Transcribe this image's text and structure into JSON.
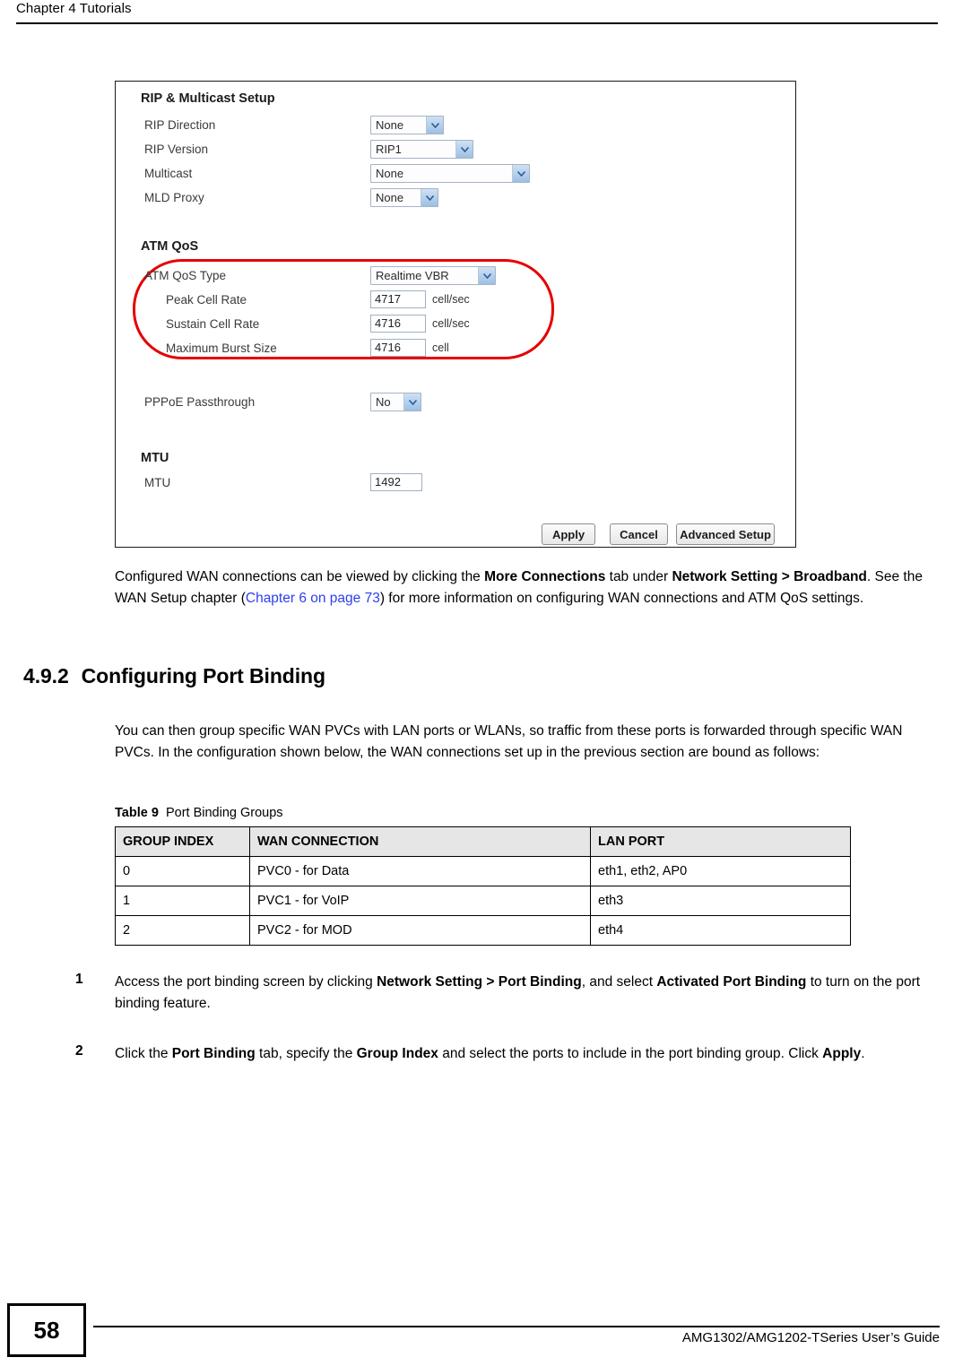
{
  "header": {
    "chapter": "Chapter 4 Tutorials"
  },
  "screenshot": {
    "rip_section": {
      "title": "RIP & Multicast Setup",
      "fields": [
        {
          "label": "RIP Direction",
          "value": "None"
        },
        {
          "label": "RIP Version",
          "value": "RIP1"
        },
        {
          "label": "Multicast",
          "value": "None"
        },
        {
          "label": "MLD Proxy",
          "value": "None"
        }
      ]
    },
    "atm_section": {
      "title": "ATM QoS",
      "qos_type": {
        "label": "ATM QoS Type",
        "value": "Realtime VBR"
      },
      "rates": [
        {
          "label": "Peak Cell Rate",
          "value": "4717",
          "unit": "cell/sec"
        },
        {
          "label": "Sustain Cell Rate",
          "value": "4716",
          "unit": "cell/sec"
        },
        {
          "label": "Maximum Burst Size",
          "value": "4716",
          "unit": "cell"
        }
      ],
      "highlight_color": "#e60000"
    },
    "pppoe": {
      "label": "PPPoE Passthrough",
      "value": "No"
    },
    "mtu_section": {
      "title": "MTU",
      "label": "MTU",
      "value": "1492"
    },
    "buttons": {
      "apply": "Apply",
      "cancel": "Cancel",
      "advanced": "Advanced Setup"
    }
  },
  "intro_paragraph": {
    "p1": "Configured WAN connections can be viewed by clicking the ",
    "b1": "More Connections",
    "p2": " tab under ",
    "b2": "Network Setting",
    "p3": " > ",
    "b3": "Broadband",
    "p4": ". See the WAN Setup chapter (",
    "xref": "Chapter 6 on page 73",
    "p5": ") for more information on configuring WAN connections and ATM QoS settings."
  },
  "section": {
    "number": "4.9.2",
    "title": "Configuring Port Binding",
    "paragraph": "You can then group specific WAN PVCs with LAN ports or WLANs, so traffic from these ports is forwarded through specific WAN PVCs. In the configuration shown below, the WAN connections set up in the previous section are bound as follows:"
  },
  "table": {
    "caption_label": "Table 9",
    "caption_title": "Port Binding Groups",
    "headers": [
      "GROUP INDEX",
      "WAN CONNECTION",
      "LAN PORT"
    ],
    "rows": [
      [
        "0",
        "PVC0 - for Data",
        "eth1, eth2, AP0"
      ],
      [
        "1",
        "PVC1 - for VoIP",
        "eth3"
      ],
      [
        "2",
        "PVC2 - for MOD",
        "eth4"
      ]
    ]
  },
  "steps": [
    {
      "num": "1",
      "t1": "Access the port binding screen by clicking ",
      "b1": "Network Setting",
      "t2": " > ",
      "b2": "Port Binding",
      "t3": ", and select ",
      "b3": "Activated Port Binding",
      "t4": " to turn on the port binding feature."
    },
    {
      "num": "2",
      "t1": "Click the ",
      "b1": "Port Binding",
      "t2": " tab, specify the ",
      "b2": "Group Index",
      "t3": " and select the ports to include in the port binding group. Click ",
      "b3": "Apply",
      "t4": "."
    }
  ],
  "footer": {
    "page_number": "58",
    "guide": "AMG1302/AMG1202-TSeries User’s Guide"
  }
}
